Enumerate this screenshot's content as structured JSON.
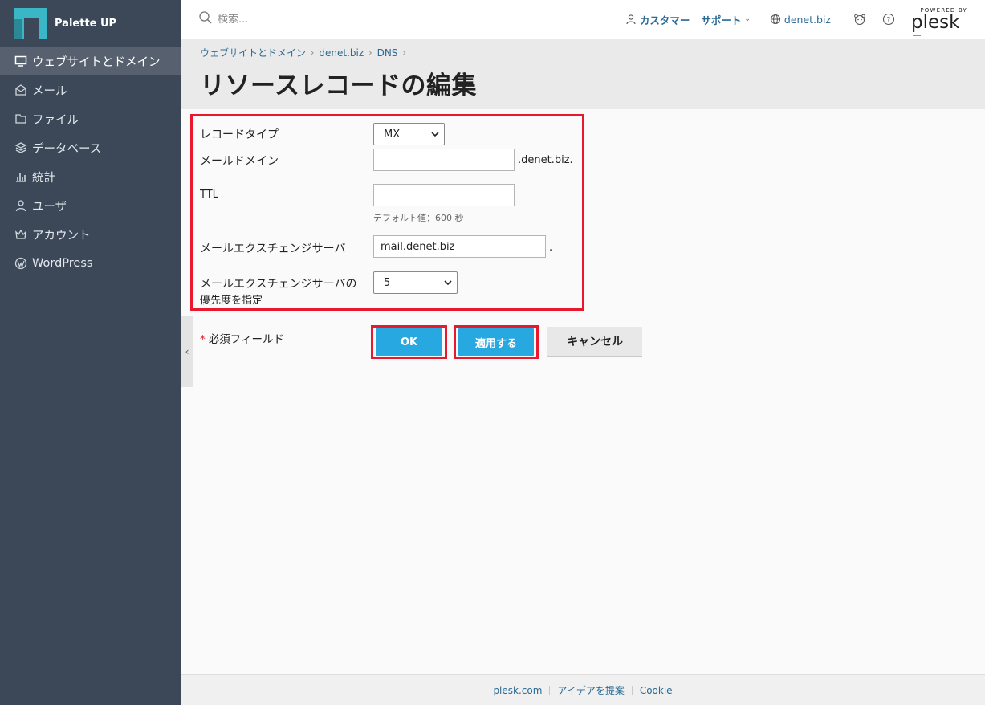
{
  "brand": {
    "name": "Palette UP",
    "accent": "#3ab7c6"
  },
  "sidebar": {
    "items": [
      {
        "label": "ウェブサイトとドメイン",
        "icon": "monitor-icon",
        "active": true
      },
      {
        "label": "メール",
        "icon": "mail-icon"
      },
      {
        "label": "ファイル",
        "icon": "folder-icon"
      },
      {
        "label": "データベース",
        "icon": "database-icon"
      },
      {
        "label": "統計",
        "icon": "chart-icon"
      },
      {
        "label": "ユーザ",
        "icon": "user-icon"
      },
      {
        "label": "アカウント",
        "icon": "crown-icon"
      },
      {
        "label": "WordPress",
        "icon": "wordpress-icon"
      }
    ]
  },
  "header": {
    "search_placeholder": "検索...",
    "customer": "カスタマー",
    "support": "サポート",
    "domain": "denet.biz",
    "powered_by": "POWERED BY",
    "plesk": "plesk"
  },
  "breadcrumb": [
    "ウェブサイトとドメイン",
    "denet.biz",
    "DNS"
  ],
  "page_title": "リソースレコードの編集",
  "form": {
    "record_type_label": "レコードタイプ",
    "record_type_value": "MX",
    "mail_domain_label": "メールドメイン",
    "mail_domain_value": "",
    "mail_domain_suffix": ".denet.biz.",
    "ttl_label": "TTL",
    "ttl_value": "",
    "ttl_hint": "デフォルト値：600 秒",
    "exchanger_label": "メールエクスチェンジサーバ",
    "exchanger_value": "mail.denet.biz",
    "exchanger_suffix": ".",
    "priority_label_1": "メールエクスチェンジサーバの",
    "priority_label_2": "優先度を指定",
    "priority_value": "5"
  },
  "required_note": "必須フィールド",
  "buttons": {
    "ok": "OK",
    "apply": "適用する",
    "cancel": "キャンセル"
  },
  "footer": [
    "plesk.com",
    "アイデアを提案",
    "Cookie"
  ],
  "colors": {
    "sidebar": "#3c4858",
    "primary_button": "#28a8e0",
    "highlight": "#e8192c",
    "link": "#2a6a95"
  }
}
